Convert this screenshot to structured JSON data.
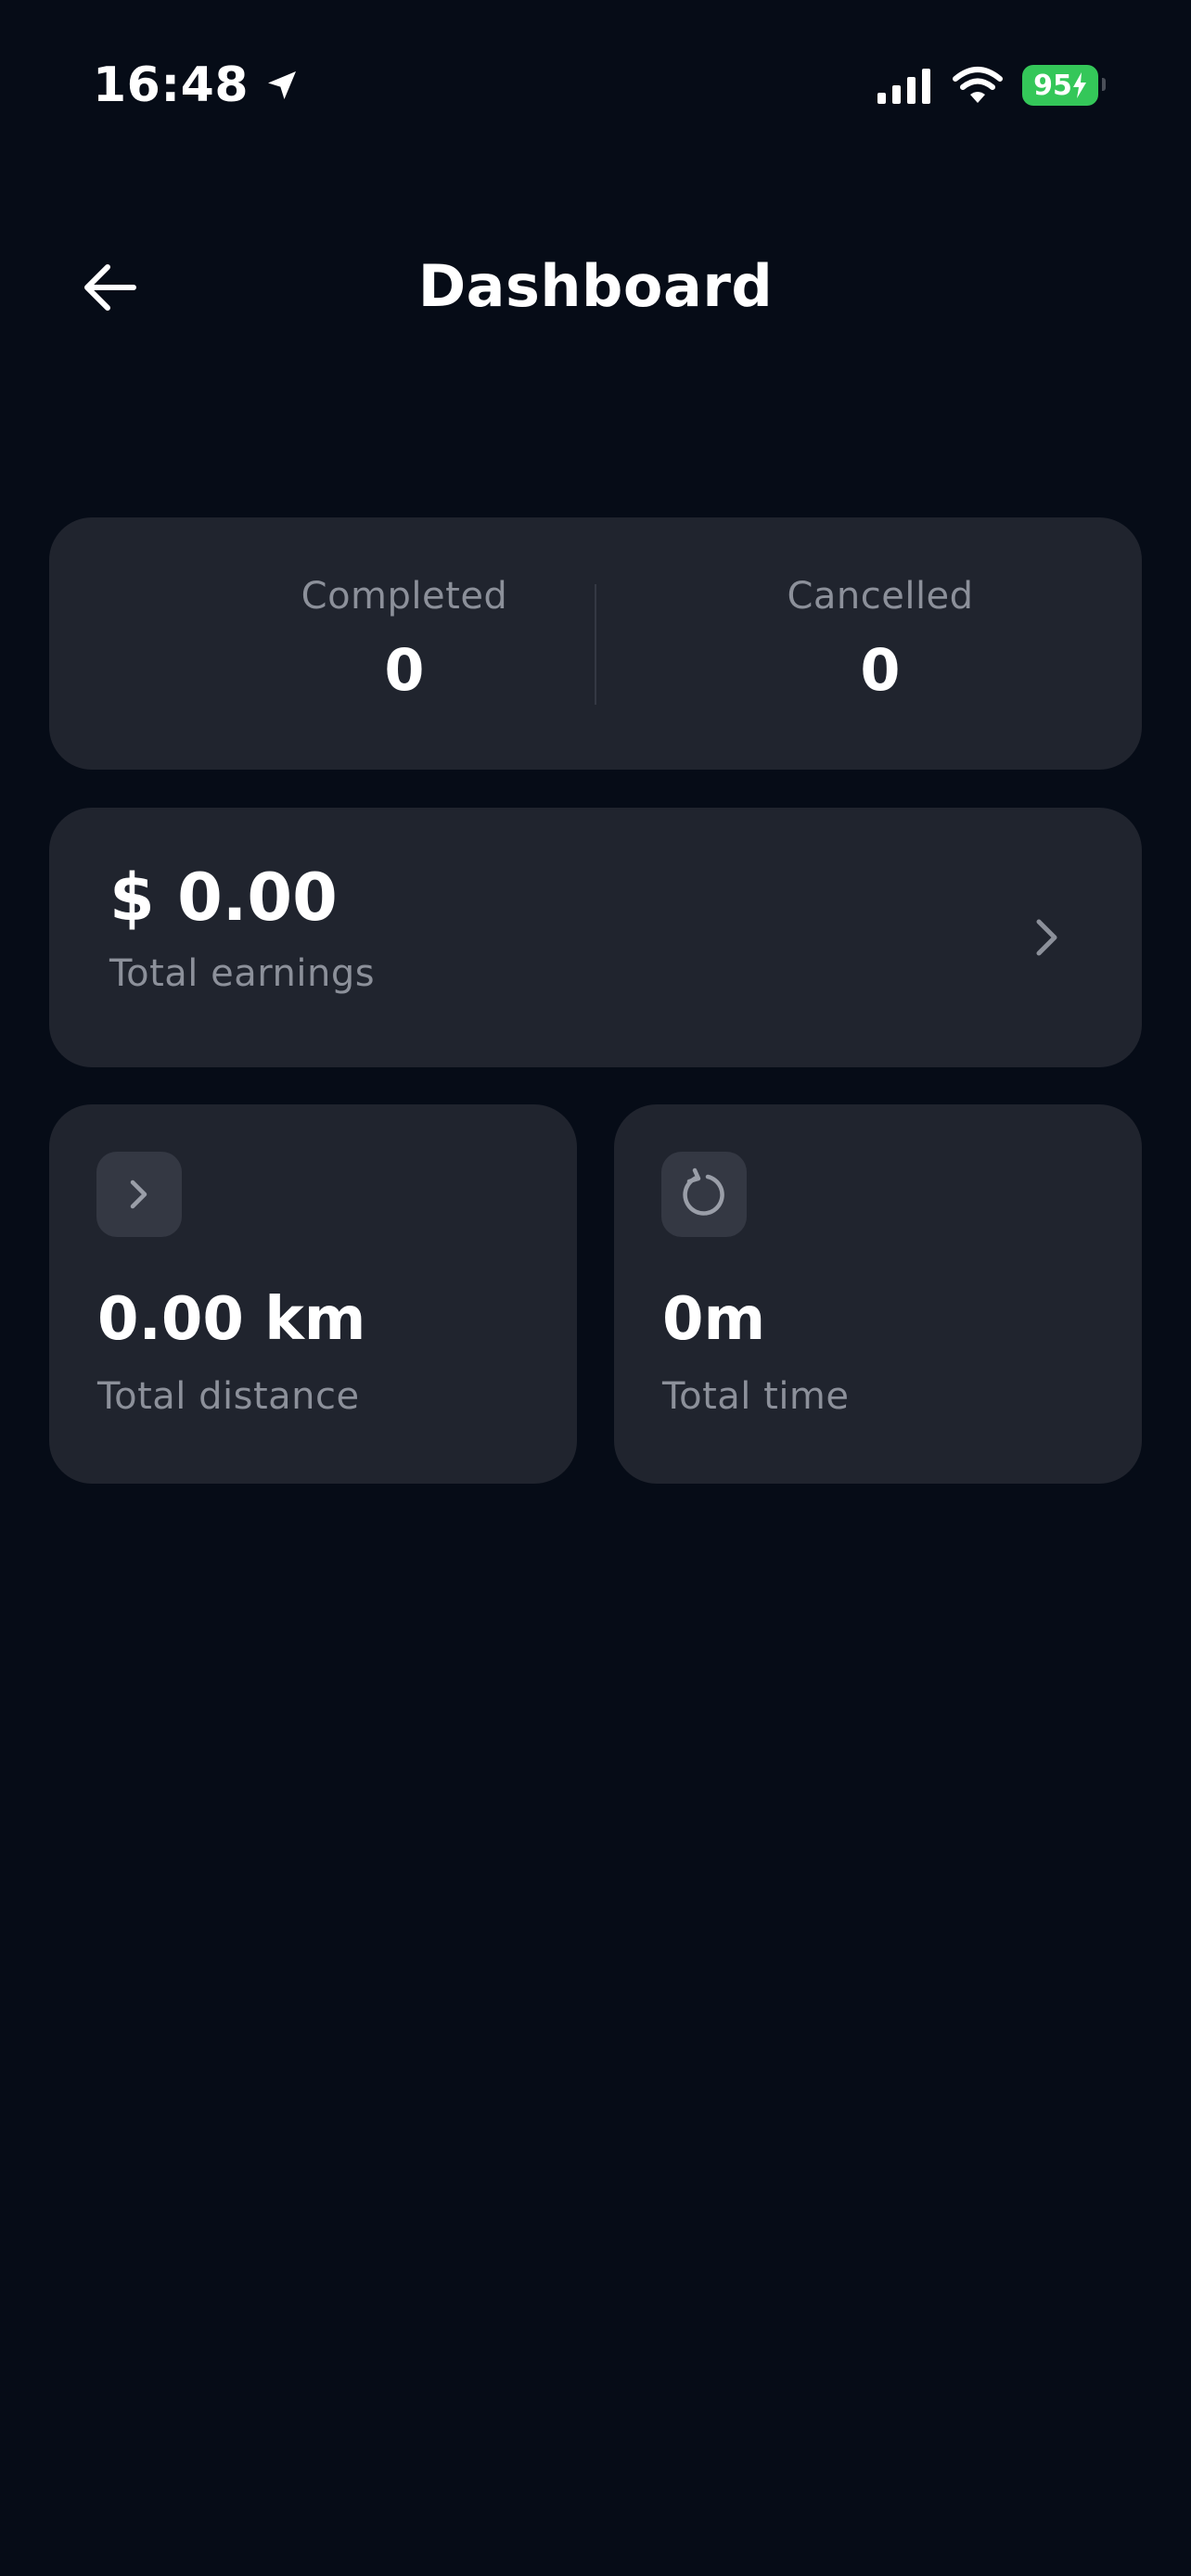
{
  "status_bar": {
    "time": "16:48",
    "battery": "95",
    "icons": [
      "location-arrow-icon",
      "signal-bars-icon",
      "wifi-icon",
      "battery-icon",
      "charging-bolt-icon"
    ]
  },
  "header": {
    "title": "Dashboard",
    "back_icon": "arrow-left-icon"
  },
  "counts": {
    "completed_label": "Completed",
    "completed_value": "0",
    "cancelled_label": "Cancelled",
    "cancelled_value": "0"
  },
  "earnings": {
    "value": "$ 0.00",
    "label": "Total earnings",
    "chevron_icon": "chevron-right-icon"
  },
  "stats": {
    "distance": {
      "icon": "chevron-right-icon",
      "value": "0.00 km",
      "label": "Total distance"
    },
    "time": {
      "icon": "refresh-icon",
      "value": "0m",
      "label": "Total time"
    }
  },
  "colors": {
    "background": "#060c17",
    "card": "#20242e",
    "icon_box": "#343843",
    "muted_text": "#8c909a",
    "battery": "#34c759"
  }
}
